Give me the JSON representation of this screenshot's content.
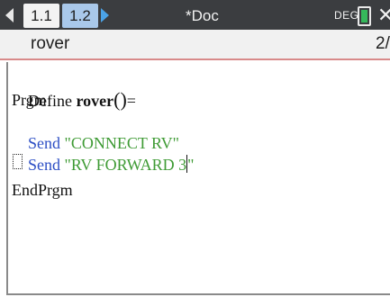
{
  "header": {
    "tabs": [
      {
        "label": "1.1"
      },
      {
        "label": "1.2"
      }
    ],
    "doc_title": "*Doc",
    "mode_label": "DEG"
  },
  "subheader": {
    "program_name": "rover",
    "position": "2/"
  },
  "editor": {
    "define_prefix": "Define ",
    "program_name": "rover",
    "parens": "()",
    "equals": "=",
    "prgm": "Prgm",
    "send1_keyword": "Send",
    "send1_string": " \"CONNECT RV\"",
    "send2_keyword": "Send",
    "send2_string_before_cursor": " \"RV FORWARD 3",
    "send2_string_after_cursor": "\"",
    "end": "EndPrgm"
  }
}
